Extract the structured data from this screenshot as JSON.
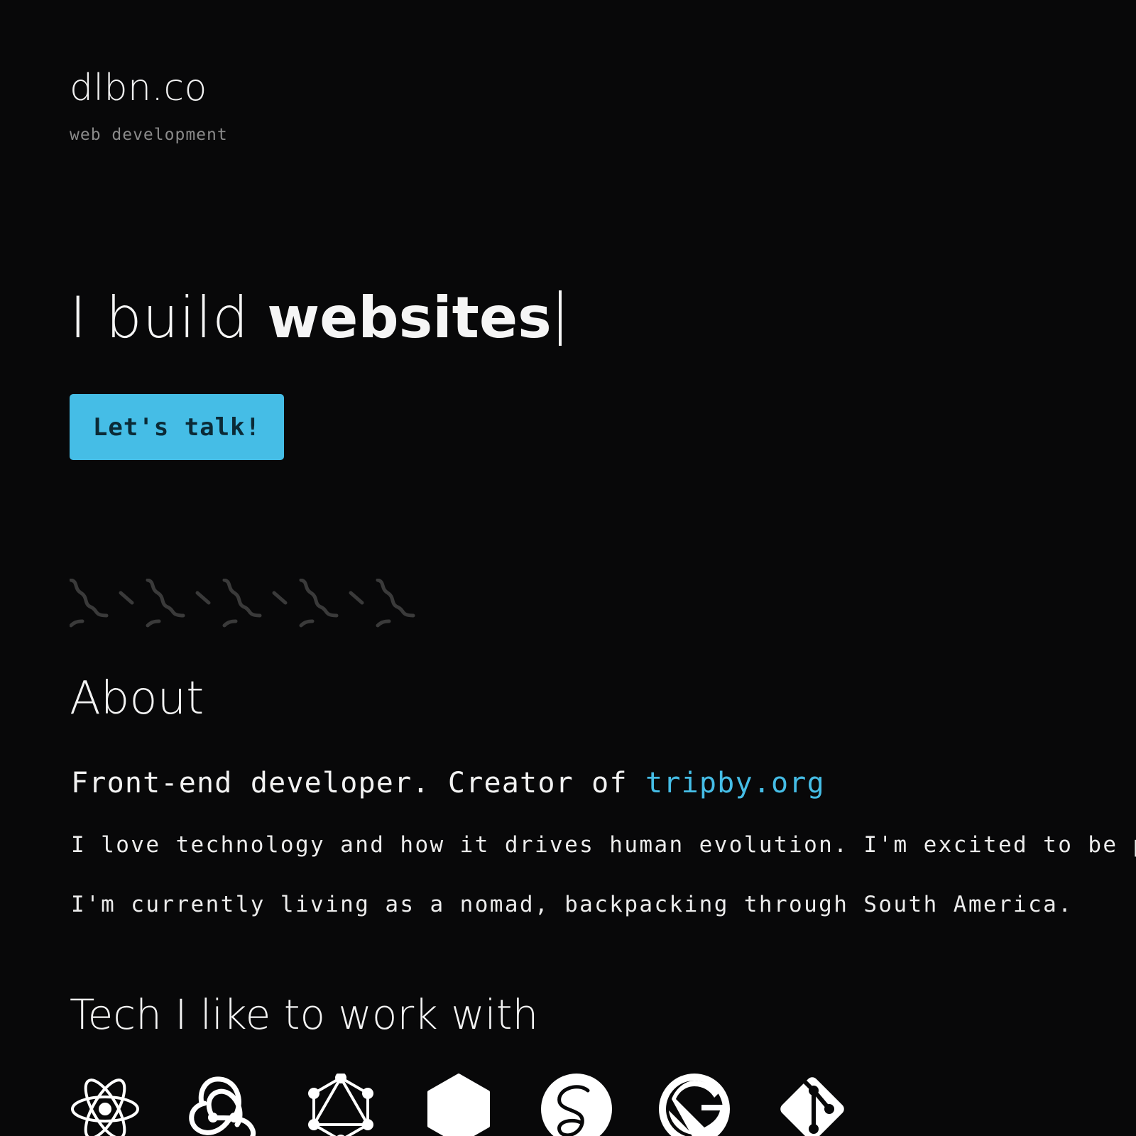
{
  "header": {
    "brand": "dlbn.co",
    "tagline": "web development"
  },
  "hero": {
    "prefix": "I build",
    "highlight": "websites",
    "cta_label": "Let's talk!"
  },
  "about": {
    "title": "About",
    "lead_text": "Front-end developer. Creator of",
    "lead_link": "tripby.org",
    "paragraph_1": "I love technology and how it drives human evolution. I'm excited to be part",
    "paragraph_2": "I'm currently living as a nomad, backpacking through South America."
  },
  "tech": {
    "title": "Tech I like to work with",
    "icons": [
      "react-icon",
      "redux-icon",
      "graphql-icon",
      "nodejs-icon",
      "sass-icon",
      "gatsby-icon",
      "git-icon"
    ]
  },
  "colors": {
    "background": "#080809",
    "accent": "#45bde6",
    "text": "#f2f2f2",
    "muted": "#8a8a8a",
    "divider": "#3a3a3a"
  }
}
